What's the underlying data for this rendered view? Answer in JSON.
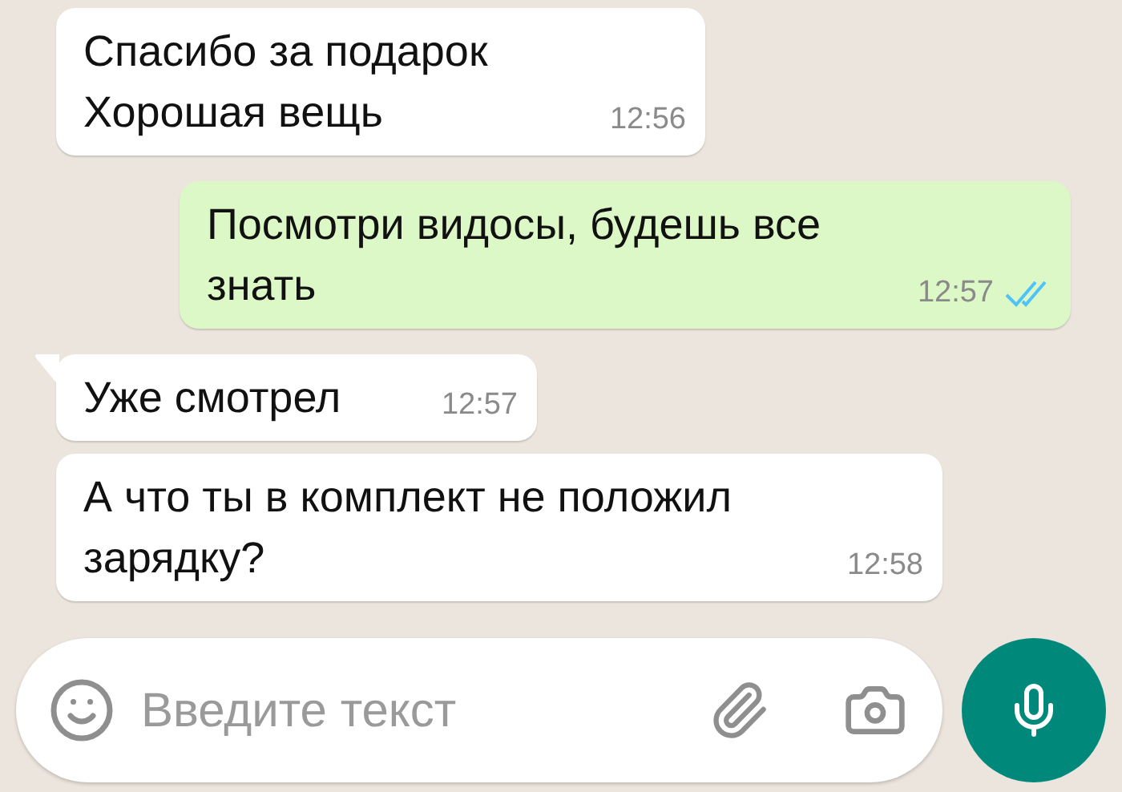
{
  "messages": [
    {
      "kind": "incoming",
      "tail": false,
      "text": "Спасибо за подарок\nХорошая вещь",
      "time": "12:56"
    },
    {
      "kind": "outgoing",
      "tail": false,
      "text": "Посмотри видосы, будешь все знать",
      "time": "12:57",
      "read": true
    },
    {
      "kind": "incoming",
      "tail": true,
      "text": "Уже смотрел",
      "time": "12:57"
    },
    {
      "kind": "incoming",
      "tail": false,
      "text": "А что ты в комплект не положил зарядку?",
      "time": "12:58"
    }
  ],
  "composer": {
    "placeholder": "Введите текст"
  }
}
